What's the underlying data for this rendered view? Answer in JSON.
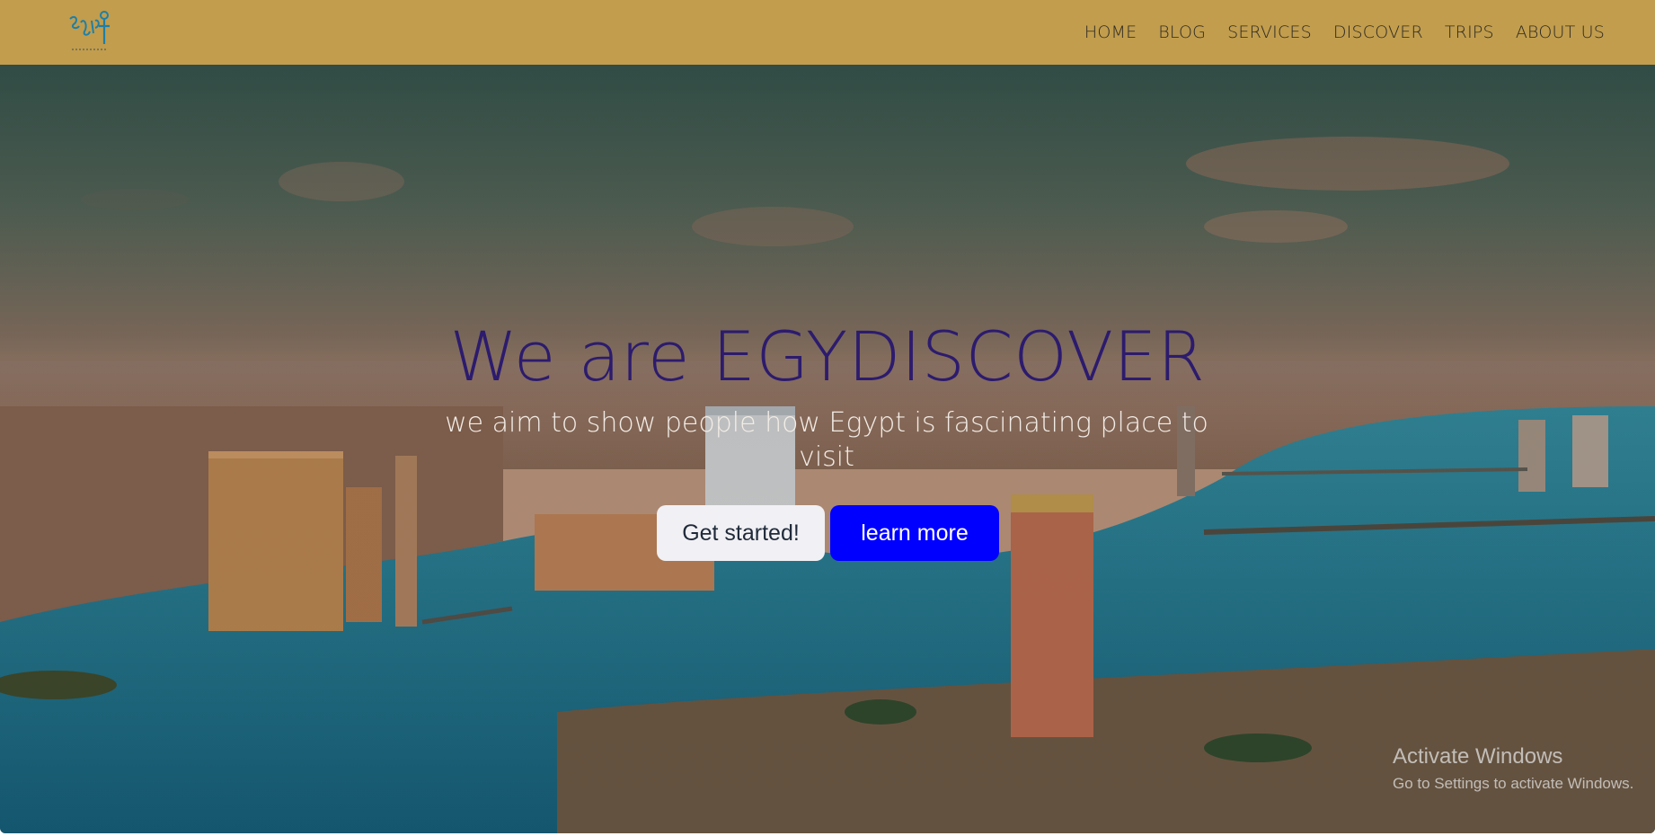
{
  "header": {
    "logo_alt": "Egypt",
    "nav": [
      {
        "label": "HOME"
      },
      {
        "label": "BLOG"
      },
      {
        "label": "SERVICES"
      },
      {
        "label": "DISCOVER"
      },
      {
        "label": "TRIPS"
      },
      {
        "label": "ABOUT US"
      }
    ]
  },
  "hero": {
    "title": "We are EGYDISCOVER",
    "subtitle": "we aim to show people how Egypt is fascinating place to visit",
    "primary_button": "Get started!",
    "secondary_button": "learn more"
  },
  "watermark": {
    "title": "Activate Windows",
    "subtitle": "Go to Settings to activate Windows."
  },
  "colors": {
    "navbar": "#c19d4d",
    "title": "#2c1b6e",
    "learn_button": "#0000ff",
    "start_button": "#f1f0f4"
  },
  "icons": {
    "logo": "egypt-logo-icon"
  }
}
